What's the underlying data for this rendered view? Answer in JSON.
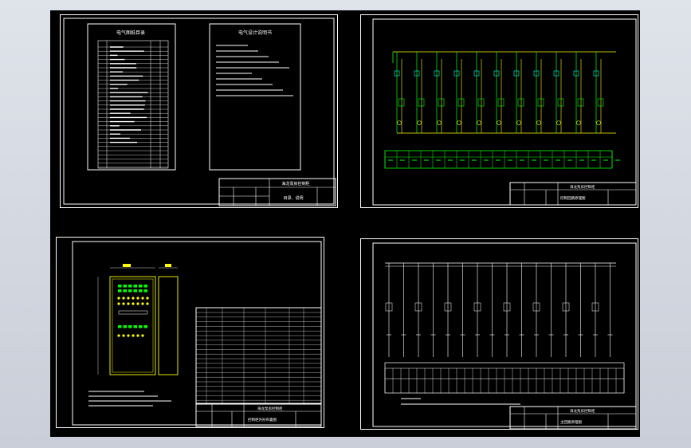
{
  "sheets": [
    {
      "id": "sheet-1",
      "left_table_title": "电气图纸目录",
      "right_table_title": "电气设计说明书",
      "title_block_main": "海龙泵房控制柜",
      "title_block_sub": "目录、说明"
    },
    {
      "id": "sheet-2",
      "title_block_main": "海龙泵房控制柜",
      "title_block_sub": "控制回路原理图"
    },
    {
      "id": "sheet-3",
      "title_block_main": "海龙泵房控制柜",
      "title_block_sub": "控制柜外形布置图"
    },
    {
      "id": "sheet-4",
      "title_block_main": "海龙泵房控制柜",
      "title_block_sub": "主回路原理图"
    }
  ],
  "colors": {
    "background": "#000000",
    "line": "#ffffff",
    "accent_green": "#00ff00",
    "accent_yellow": "#ffff00",
    "accent_cyan": "#00ffff"
  }
}
